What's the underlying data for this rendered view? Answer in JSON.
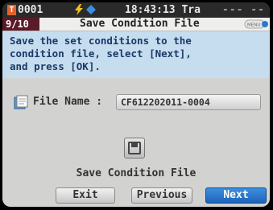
{
  "status": {
    "slot": "0001",
    "clock": "18:43:13 Tra",
    "dashes": "--- ---"
  },
  "titlebar": {
    "page": "9/10",
    "title": "Save Condition File",
    "menu_icon_label": "MENU"
  },
  "instruction": {
    "lines": [
      "Save the set conditions to the",
      "condition file, select [Next],",
      "and press [OK]."
    ]
  },
  "file": {
    "label": "File Name : ",
    "value": "CF612202011-0004"
  },
  "save": {
    "caption": "Save Condition File"
  },
  "buttons": {
    "exit": "Exit",
    "previous": "Previous",
    "next": "Next"
  },
  "colors": {
    "instruction_bg": "#c6ddf0",
    "page_badge": "#5a1a2a",
    "accent_blue": "#2a78d0"
  }
}
